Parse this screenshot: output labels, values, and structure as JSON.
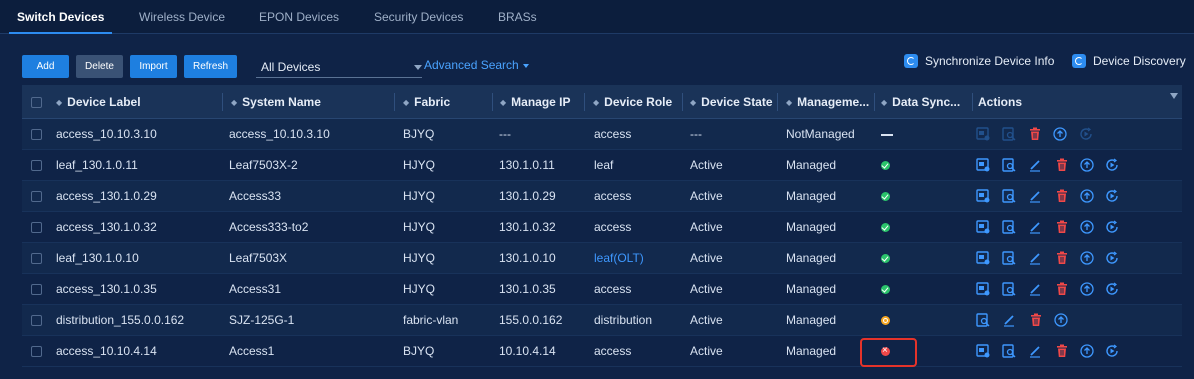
{
  "tabs": [
    {
      "label": "Switch Devices",
      "active": true
    },
    {
      "label": "Wireless Device",
      "active": false
    },
    {
      "label": "EPON Devices",
      "active": false
    },
    {
      "label": "Security Devices",
      "active": false
    },
    {
      "label": "BRASs",
      "active": false
    }
  ],
  "toolbar": {
    "add": "Add",
    "delete": "Delete",
    "import": "Import",
    "refresh": "Refresh",
    "device_filter": "All Devices",
    "advanced_search": "Advanced Search",
    "sync_info": "Synchronize Device Info",
    "discovery": "Device Discovery"
  },
  "columns": [
    "Device Label",
    "System Name",
    "Fabric",
    "Manage IP",
    "Device Role",
    "Device State",
    "Manageme...",
    "Data Sync...",
    "Actions"
  ],
  "rows": [
    {
      "label": "access_10.10.3.10",
      "system": "access_10.10.3.10",
      "fabric": "BJYQ",
      "ip": "---",
      "role": "access",
      "role_link": false,
      "state": "---",
      "manage": "NotManaged",
      "sync": "dash",
      "actions": "disabled"
    },
    {
      "label": "leaf_130.1.0.11",
      "system": "Leaf7503X-2",
      "fabric": "HJYQ",
      "ip": "130.1.0.11",
      "role": "leaf",
      "role_link": false,
      "state": "Active",
      "manage": "Managed",
      "sync": "ok",
      "actions": "full"
    },
    {
      "label": "access_130.1.0.29",
      "system": "Access33",
      "fabric": "HJYQ",
      "ip": "130.1.0.29",
      "role": "access",
      "role_link": false,
      "state": "Active",
      "manage": "Managed",
      "sync": "ok",
      "actions": "full"
    },
    {
      "label": "access_130.1.0.32",
      "system": "Access333-to2",
      "fabric": "HJYQ",
      "ip": "130.1.0.32",
      "role": "access",
      "role_link": false,
      "state": "Active",
      "manage": "Managed",
      "sync": "ok",
      "actions": "full"
    },
    {
      "label": "leaf_130.1.0.10",
      "system": "Leaf7503X",
      "fabric": "HJYQ",
      "ip": "130.1.0.10",
      "role": "leaf(OLT)",
      "role_link": true,
      "state": "Active",
      "manage": "Managed",
      "sync": "ok",
      "actions": "full"
    },
    {
      "label": "access_130.1.0.35",
      "system": "Access31",
      "fabric": "HJYQ",
      "ip": "130.1.0.35",
      "role": "access",
      "role_link": false,
      "state": "Active",
      "manage": "Managed",
      "sync": "ok",
      "actions": "full"
    },
    {
      "label": "distribution_155.0.0.162",
      "system": "SJZ-125G-1",
      "fabric": "fabric-vlan",
      "ip": "155.0.0.162",
      "role": "distribution",
      "role_link": false,
      "state": "Active",
      "manage": "Managed",
      "sync": "warn",
      "actions": "reduced"
    },
    {
      "label": "access_10.10.4.14",
      "system": "Access1",
      "fabric": "BJYQ",
      "ip": "10.10.4.14",
      "role": "access",
      "role_link": false,
      "state": "Active",
      "manage": "Managed",
      "sync": "err",
      "actions": "full"
    }
  ],
  "colors": {
    "accent": "#1e7fe0",
    "link": "#3e98ff",
    "ok": "#2ac36b",
    "warn": "#f5a623",
    "error": "#f04848",
    "highlight": "#e5332a"
  }
}
